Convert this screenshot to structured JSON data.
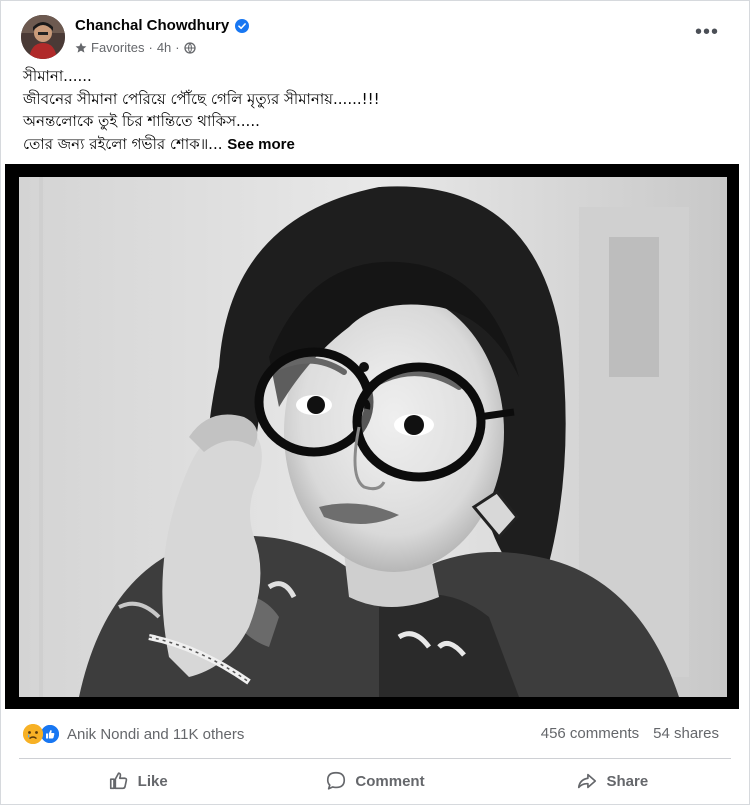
{
  "post": {
    "author": "Chanchal Chowdhury",
    "audience": "Favorites",
    "time": "4h",
    "separator": "·",
    "more_icon": "more-dots-icon",
    "text_lines": [
      "সীমানা......",
      "জীবনের সীমানা পেরিয়ে পৌঁছে গেলি মৃত্যুর সীমানায়......!!!",
      "অনন্তলোকে তুই চির শান্তিতে থাকিস.....",
      "তোর জন্য রইলো গভীর শোক॥..."
    ],
    "see_more": "See more",
    "colors": {
      "verified": "#1877f2",
      "secondary_text": "#65676b",
      "like_blue": "#1877f2",
      "sad_yellow": "#f7b125"
    }
  },
  "stats": {
    "reactors": "Anik Nondi and 11K others",
    "comments": "456 comments",
    "shares": "54 shares"
  },
  "actions": {
    "like": "Like",
    "comment": "Comment",
    "share": "Share"
  }
}
